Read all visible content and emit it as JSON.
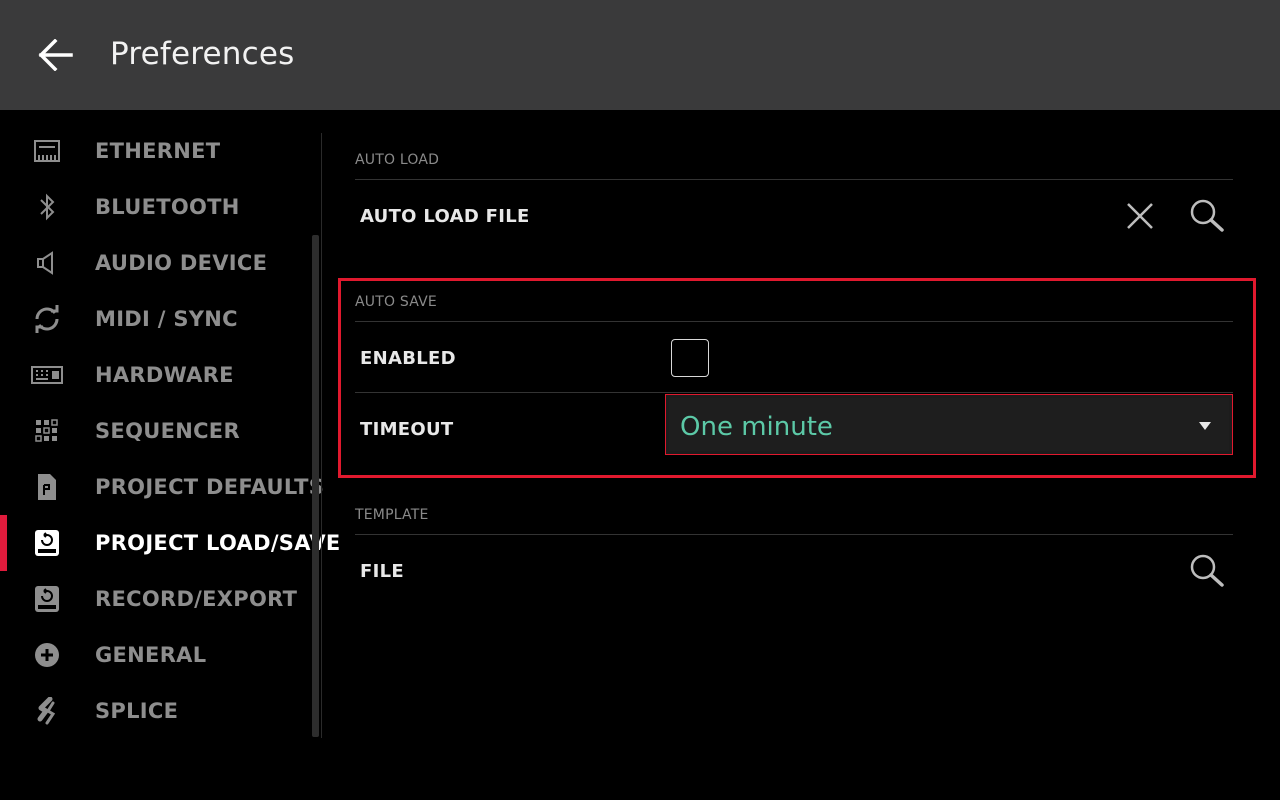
{
  "header": {
    "title": "Preferences",
    "back_icon": "arrow-left-icon"
  },
  "sidebar": {
    "active_index": 7,
    "accent_color": "#e01b3c",
    "items": [
      {
        "label": "ETHERNET",
        "icon": "ethernet-icon"
      },
      {
        "label": "BLUETOOTH",
        "icon": "bluetooth-icon"
      },
      {
        "label": "AUDIO DEVICE",
        "icon": "speaker-icon"
      },
      {
        "label": "MIDI / SYNC",
        "icon": "sync-icon"
      },
      {
        "label": "HARDWARE",
        "icon": "keyboard-icon"
      },
      {
        "label": "SEQUENCER",
        "icon": "grid-icon"
      },
      {
        "label": "PROJECT DEFAULTS",
        "icon": "document-icon"
      },
      {
        "label": "PROJECT LOAD/SAVE",
        "icon": "drive-load-icon"
      },
      {
        "label": "RECORD/EXPORT",
        "icon": "drive-record-icon"
      },
      {
        "label": "GENERAL",
        "icon": "plus-circle-icon"
      },
      {
        "label": "SPLICE",
        "icon": "splice-icon"
      }
    ]
  },
  "main": {
    "auto_load": {
      "section_label": "AUTO LOAD",
      "file_label": "AUTO LOAD FILE",
      "clear_icon": "close-icon",
      "browse_icon": "search-icon"
    },
    "auto_save": {
      "section_label": "AUTO SAVE",
      "enabled_label": "ENABLED",
      "enabled_checked": false,
      "timeout_label": "TIMEOUT",
      "timeout_value": "One minute",
      "highlight_color": "#e0192e",
      "value_color": "#5cc9a7"
    },
    "template": {
      "section_label": "TEMPLATE",
      "file_label": "FILE",
      "browse_icon": "search-icon"
    }
  }
}
